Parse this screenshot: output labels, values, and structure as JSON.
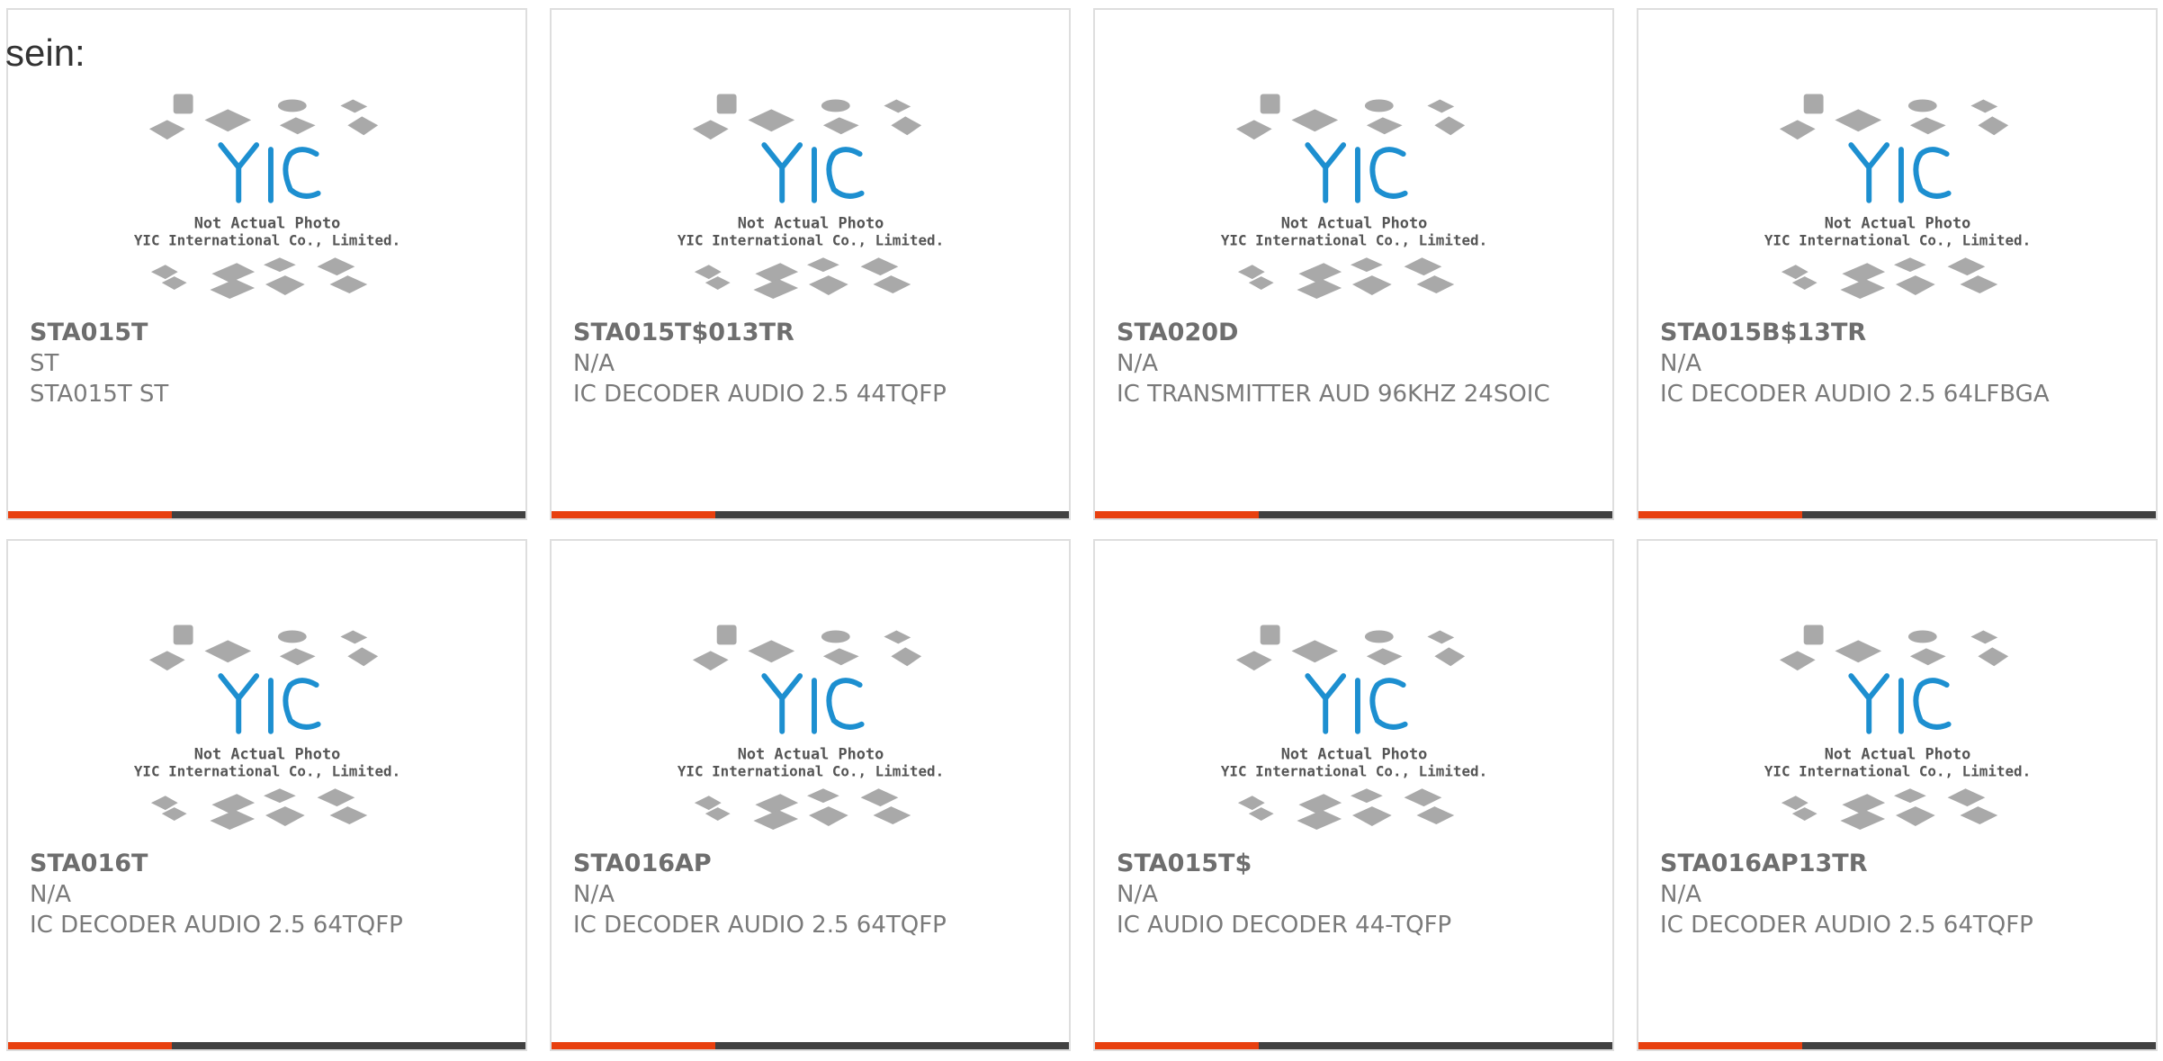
{
  "intro_text": "sein:",
  "image_caption": {
    "line1": "Not Actual Photo",
    "line2": "YIC International Co., Limited.",
    "logo": "YIC"
  },
  "products": [
    {
      "part": "STA015T",
      "maker": "ST",
      "desc": "STA015T ST"
    },
    {
      "part": "STA015T$013TR",
      "maker": "N/A",
      "desc": "IC DECODER AUDIO 2.5 44TQFP"
    },
    {
      "part": "STA020D",
      "maker": "N/A",
      "desc": "IC TRANSMITTER AUD 96KHZ 24SOIC"
    },
    {
      "part": "STA015B$13TR",
      "maker": "N/A",
      "desc": "IC DECODER AUDIO 2.5 64LFBGA"
    },
    {
      "part": "STA016T",
      "maker": "N/A",
      "desc": "IC DECODER AUDIO 2.5 64TQFP"
    },
    {
      "part": "STA016AP",
      "maker": "N/A",
      "desc": "IC DECODER AUDIO 2.5 64TQFP"
    },
    {
      "part": "STA015T$",
      "maker": "N/A",
      "desc": "IC AUDIO DECODER 44-TQFP"
    },
    {
      "part": "STA016AP13TR",
      "maker": "N/A",
      "desc": "IC DECODER AUDIO 2.5 64TQFP"
    }
  ],
  "colors": {
    "accent": "#e8400f",
    "bar": "#414141",
    "logo": "#1d8fd0"
  }
}
